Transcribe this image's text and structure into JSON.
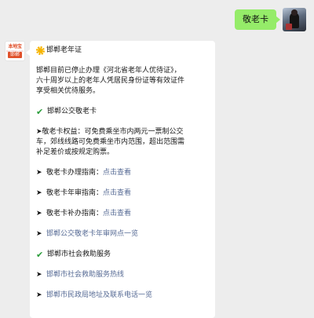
{
  "outgoing": {
    "text": "敬老卡"
  },
  "incoming": {
    "avatar": {
      "brand_top": "本地宝",
      "brand_mid": "bendibao.com",
      "brand_bottom": "邯郸"
    },
    "heading_1": "邯郸老年证",
    "para_1": [
      "邯郸目前已停止办理《河北省老年人优待证》，",
      "六十周岁以上的老年人凭居民身份证等有效证件",
      "享受相关优待服务。"
    ],
    "heading_2": "邯郸公交敬老卡",
    "para_2": [
      "➤敬老卡权益：可免费乘坐市内两元一票制公交",
      "车，郊线线路可免费乘坐市内范围，超出范围需",
      "补足差价或按规定购票。"
    ],
    "guide_1": {
      "label": "敬老卡办理指南：",
      "link": "点击查看"
    },
    "guide_2": {
      "label": "敬老卡年审指南：",
      "link": "点击查看"
    },
    "guide_3": {
      "label": "敬老卡补办指南：",
      "link": "点击查看"
    },
    "link_1": "邯郸公交敬老卡年审网点一览",
    "heading_3": "邯郸市社会救助服务",
    "link_2": "邯郸市社会救助服务热线",
    "link_3": "邯郸市民政局地址及联系电话一览"
  },
  "colors": {
    "background": "#ededed",
    "outgoing_bubble": "#95ec69",
    "link": "#576b95",
    "check": "#2a9d3a",
    "sun": "#f7b500"
  }
}
